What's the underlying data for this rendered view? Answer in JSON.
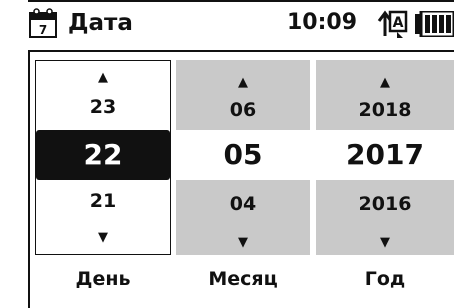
{
  "header": {
    "calendar_icon": "calendar-icon",
    "calendar_day": "7",
    "title": "Дата",
    "time": "10:09",
    "ime_icon": "input-mode-icon",
    "ime_letter": "A",
    "battery_icon": "battery-icon"
  },
  "picker": {
    "day": {
      "label": "День",
      "prev": "23",
      "selected": "22",
      "next": "21",
      "up_arrow": "▲",
      "down_arrow": "▼"
    },
    "month": {
      "label": "Месяц",
      "prev": "06",
      "selected": "05",
      "next": "04",
      "up_arrow": "▲",
      "down_arrow": "▼"
    },
    "year": {
      "label": "Год",
      "prev": "2018",
      "selected": "2017",
      "next": "2016",
      "up_arrow": "▲",
      "down_arrow": "▼"
    }
  },
  "colors": {
    "focus_bg": "#111111",
    "focus_text": "#ffffff",
    "inactive_column_bg": "#c9c9c9"
  }
}
